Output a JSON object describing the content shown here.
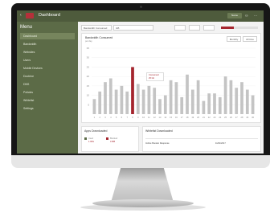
{
  "app": {
    "title": "Dashboard",
    "user_button": "Name",
    "colors": {
      "topbar": "#4e5b3c",
      "sidebar": "#5c6b47",
      "accent": "#a5252e",
      "bar": "#c4c4c4"
    }
  },
  "sidebar": {
    "title": "Menu",
    "items": [
      {
        "label": "Dashboard"
      },
      {
        "label": "Bandwidth"
      },
      {
        "label": "Websites"
      },
      {
        "label": "Users"
      },
      {
        "label": "Mobile Devices"
      },
      {
        "label": "Doctrine"
      },
      {
        "label": "DNS"
      },
      {
        "label": "Policies"
      },
      {
        "label": "Whitelist"
      },
      {
        "label": "Settings"
      }
    ]
  },
  "toolbar": {
    "metric_select": "Bandwidth Consumed",
    "range_select": "GB"
  },
  "chart_card": {
    "title": "Bandwidth Consumed",
    "subtitle": "per day",
    "toggle_monthly": "Monthly",
    "toggle_all": "All time",
    "tooltip_title": "Consumed",
    "tooltip_value": "25 Gb"
  },
  "chart_data": {
    "type": "bar",
    "categories": [
      "1",
      "2",
      "3",
      "4",
      "5",
      "6",
      "7",
      "8",
      "9",
      "10",
      "11",
      "12",
      "13",
      "14",
      "15",
      "16",
      "17",
      "18",
      "19",
      "20",
      "21",
      "22",
      "23",
      "24",
      "25",
      "26",
      "27",
      "28",
      "29",
      "30"
    ],
    "values": [
      8,
      12,
      17,
      19,
      13,
      15,
      12,
      25,
      16,
      13,
      15,
      14,
      8,
      10,
      18,
      17,
      9,
      21,
      13,
      18,
      7,
      11,
      11,
      9,
      20,
      18,
      14,
      17,
      13,
      10
    ],
    "highlight_index": 7,
    "ylim": [
      0,
      35
    ],
    "yticks": [
      5,
      10,
      15,
      20,
      25,
      30,
      35
    ]
  },
  "bottom_left": {
    "title": "Apps Downloaded",
    "legend_a": "Used",
    "legend_a_value": "1.00G",
    "legend_b": "Blocked",
    "legend_b_value": "4 MB"
  },
  "bottom_right": {
    "title": "Whitelist Downloaded",
    "row_label": "Incline Booster Response",
    "row_date": "11/01/2017"
  }
}
